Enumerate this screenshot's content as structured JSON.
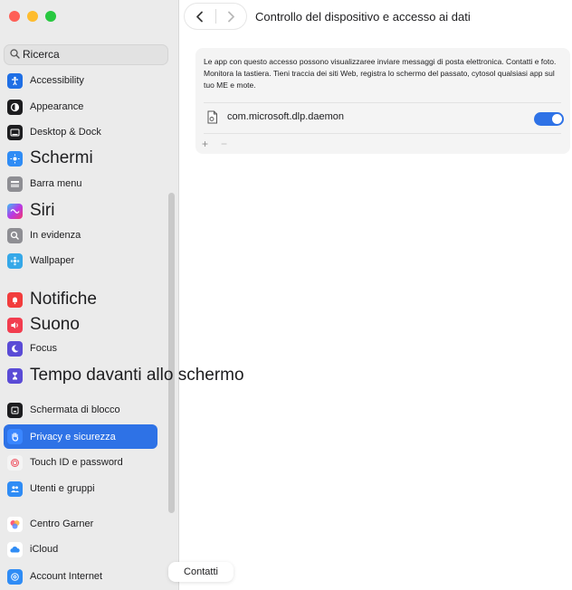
{
  "window": {
    "title": "Controllo del dispositivo e accesso ai dati",
    "traffic_colors": [
      "#fe5f57",
      "#febc2e",
      "#28c840"
    ]
  },
  "search": {
    "placeholder": "Ricerca"
  },
  "sidebar": {
    "items": [
      {
        "label": "Accessibility",
        "icon": "accessibility-icon",
        "color": "#1f6fe5"
      },
      {
        "label": "Appearance",
        "icon": "appearance-icon",
        "color": "#1d1d1f"
      },
      {
        "label": "Desktop & Dock",
        "icon": "dock-icon",
        "color": "#1d1d1f"
      },
      {
        "label": "Schermi",
        "icon": "displays-icon",
        "color": "#2f8cf5"
      },
      {
        "label": "Barra menu",
        "icon": "menu-bar-icon",
        "color": "#8e8e93"
      },
      {
        "label": "Siri",
        "icon": "siri-icon",
        "color": "#6b3fd1"
      },
      {
        "label": "In evidenza",
        "icon": "spotlight-icon",
        "color": "#8e8e93"
      },
      {
        "label": "Wallpaper",
        "icon": "wallpaper-icon",
        "color": "#35a8e8"
      },
      {
        "label": "Notifiche",
        "icon": "notifications-icon",
        "color": "#f23d3d"
      },
      {
        "label": "Suono",
        "icon": "sound-icon",
        "color": "#f23d4f"
      },
      {
        "label": "Focus",
        "icon": "focus-icon",
        "color": "#5a4bd6"
      },
      {
        "label": "Tempo davanti allo schermo",
        "icon": "screen-time-icon",
        "color": "#5a4bd6"
      },
      {
        "label": "Schermata di blocco",
        "icon": "lock-screen-icon",
        "color": "#1d1d1f"
      },
      {
        "label": "Privacy e sicurezza",
        "icon": "hand-icon",
        "color": "#3a86ff"
      },
      {
        "label": "Touch ID e password",
        "icon": "fingerprint-icon",
        "color": "#f4f4f4"
      },
      {
        "label": "Utenti e gruppi",
        "icon": "users-icon",
        "color": "#2f8cf5"
      },
      {
        "label": "Centro Garner",
        "icon": "game-center-icon",
        "color": "#ff6b8a"
      },
      {
        "label": "iCloud",
        "icon": "icloud-icon",
        "color": "#2f8cf5"
      },
      {
        "label": "Account Internet",
        "icon": "internet-accounts-icon",
        "color": "#2f8cf5"
      }
    ]
  },
  "panel": {
    "description": "Le app con questo accesso possono visualizzaree inviare messaggi di posta elettronica. Contatti e foto. Monitora la tastiera. Tieni traccia dei siti Web, registra lo schermo del passato, cytosol qualsiasi app sul tuo ME e mote.",
    "app_name": "com.microsoft.dlp.daemon",
    "toggle_on": true,
    "accent": "#2e72e6",
    "add_label": "+",
    "remove_label": "−"
  },
  "tooltip": {
    "label": "Contatti"
  }
}
